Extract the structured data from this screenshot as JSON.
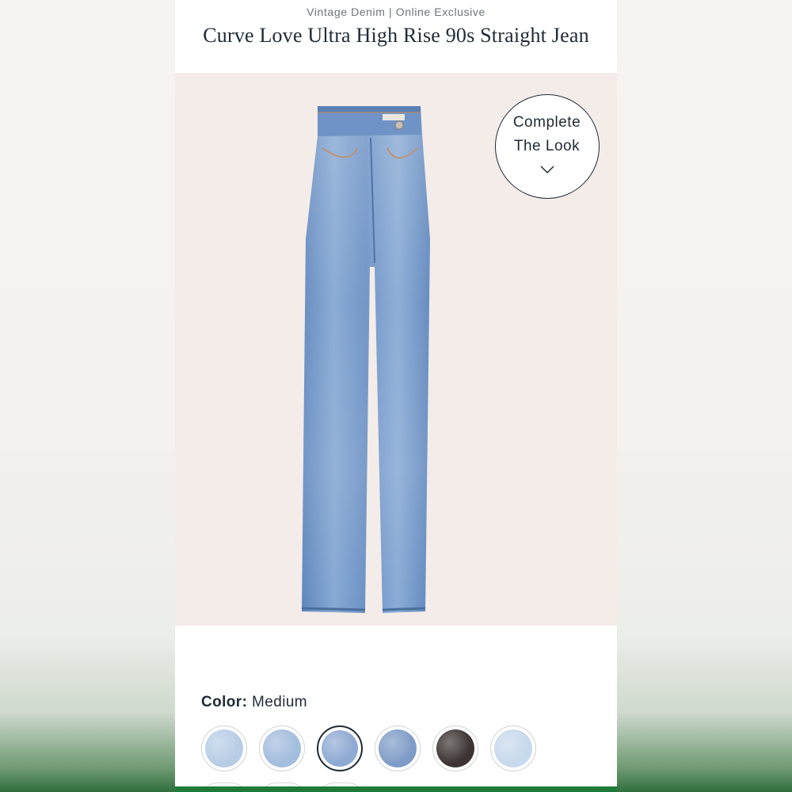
{
  "product": {
    "kicker": "Vintage Denim | Online Exclusive",
    "title": "Curve Love Ultra High Rise 90s Straight Jean"
  },
  "image": {
    "alt": "jeans-product-photo",
    "background_color": "#f3ece9",
    "denim_color": "#7fa2cf"
  },
  "complete_the_look": {
    "line1": "Complete",
    "line2": "The Look",
    "icon": "chevron-down-icon"
  },
  "color_selector": {
    "label": "Color:",
    "value": "Medium",
    "swatches": [
      {
        "name": "light-wash",
        "color": "#b7cde6",
        "selected": false
      },
      {
        "name": "light-medium-wash",
        "color": "#a3bddd",
        "selected": false
      },
      {
        "name": "medium-wash",
        "color": "#8eaad3",
        "selected": true
      },
      {
        "name": "medium-dark-wash",
        "color": "#7f9cc7",
        "selected": false
      },
      {
        "name": "black-wash",
        "color": "#3c3433",
        "selected": false
      },
      {
        "name": "bleach-wash",
        "color": "#c7d9ec",
        "selected": false
      }
    ]
  },
  "colors": {
    "text_dark": "#1f2a36",
    "text_muted": "#6f747a",
    "brand_green": "#1d7a38"
  }
}
